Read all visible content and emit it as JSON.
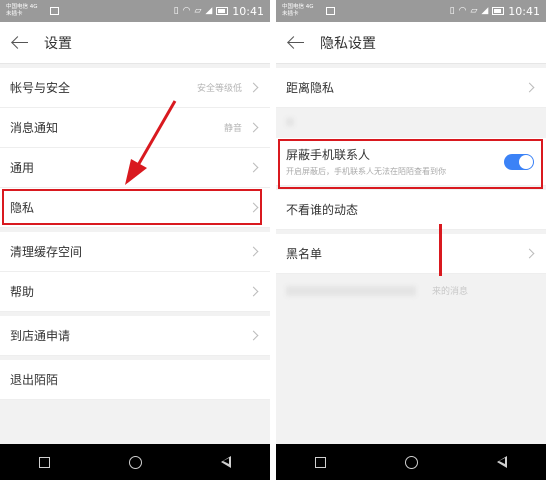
{
  "status_bar": {
    "carrier_line1": "中国电信 4G",
    "carrier_line2": "未插卡",
    "time": "10:41"
  },
  "left_screen": {
    "title": "设置",
    "rows": [
      {
        "label": "帐号与安全",
        "value": "安全等级低"
      },
      {
        "label": "消息通知",
        "value": "静音"
      },
      {
        "label": "通用",
        "value": ""
      },
      {
        "label": "隐私",
        "value": ""
      },
      {
        "label": "清理缓存空间",
        "value": ""
      },
      {
        "label": "帮助",
        "value": ""
      },
      {
        "label": "到店通申请",
        "value": ""
      },
      {
        "label": "退出陌陌",
        "value": ""
      }
    ]
  },
  "right_screen": {
    "title": "隐私设置",
    "distance_privacy": "距离隐私",
    "block_contacts_label": "屏蔽手机联系人",
    "block_contacts_sub": "开启屏蔽后，手机联系人无法在陌陌查看到你",
    "block_contacts_on": true,
    "hide_feed_label": "不看谁的动态",
    "blacklist_label": "黑名单",
    "faint_text": "来的消息"
  },
  "colors": {
    "highlight": "#d9191f",
    "toggle_on": "#3b82f6",
    "status_bar": "#9a9a9a"
  },
  "icons": {
    "back": "back-arrow-icon",
    "chevron": "chevron-right-icon",
    "nav_recent": "square-icon",
    "nav_home": "circle-icon",
    "nav_back": "triangle-back-icon"
  }
}
